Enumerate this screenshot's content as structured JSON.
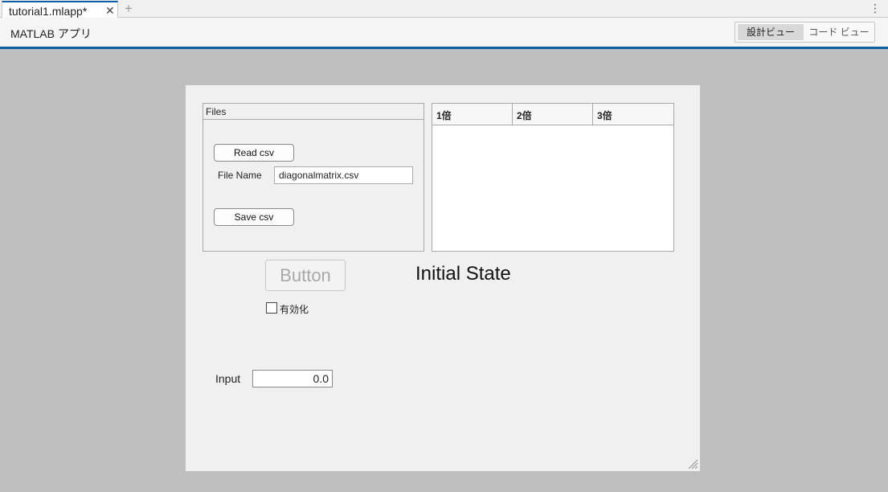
{
  "tab": {
    "label": "tutorial1.mlapp*",
    "close_icon": "close-icon",
    "add_icon": "plus-icon"
  },
  "menu": {
    "icon": "vertical-ellipsis-icon",
    "glyph": "⋮"
  },
  "header": {
    "title": "MATLAB アプリ",
    "design_view": "設計ビュー",
    "code_view": "コード ビュー"
  },
  "files_panel": {
    "title": "Files",
    "read_button": "Read csv",
    "file_name_label": "File Name",
    "file_name_value": "diagonalmatrix.csv",
    "save_button": "Save csv"
  },
  "table": {
    "columns": [
      "1倍",
      "2倍",
      "3倍"
    ]
  },
  "big_button": {
    "label": "Button",
    "enabled": false
  },
  "state_label": "Initial State",
  "checkbox": {
    "label": "有効化",
    "checked": false
  },
  "input": {
    "label": "Input",
    "value": "0.0"
  },
  "colors": {
    "accent": "#0e5ea3",
    "background": "#bfbfbf",
    "canvas": "#f0f0f0",
    "disabled_text": "#a8a8a8"
  }
}
